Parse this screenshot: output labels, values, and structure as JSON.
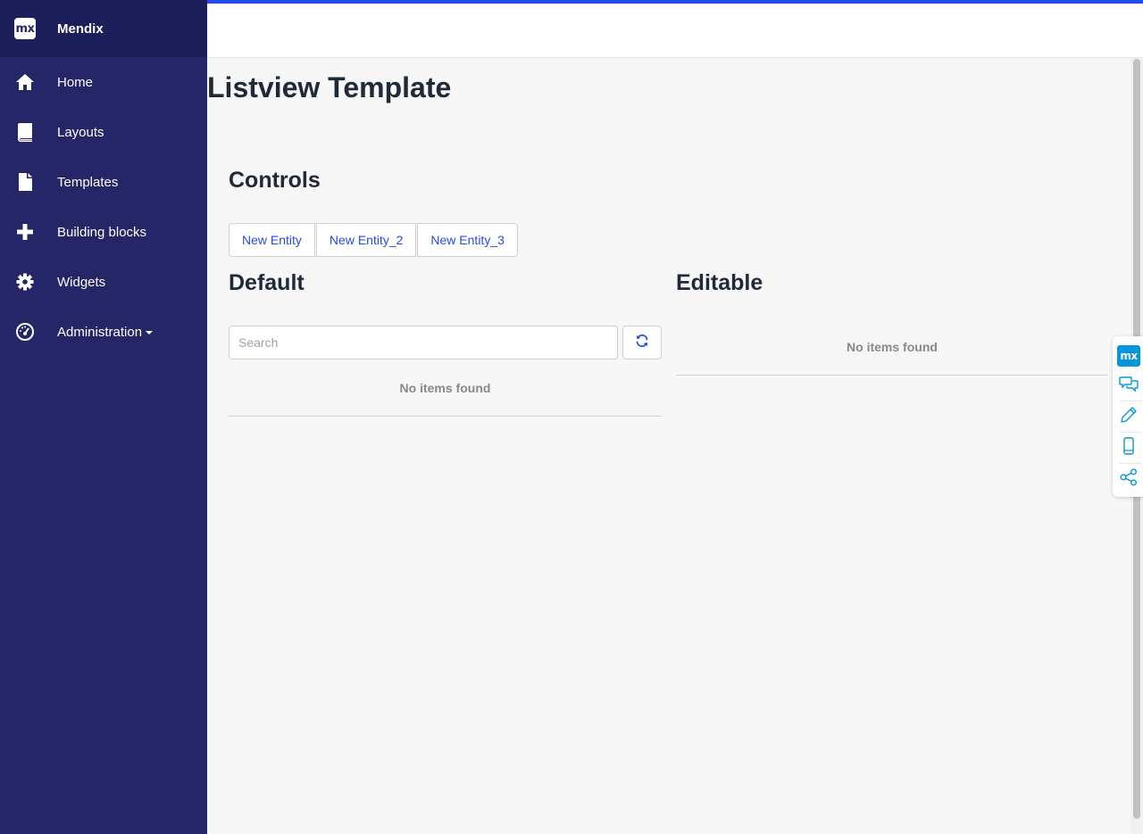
{
  "sidebar": {
    "brand": {
      "logo_text": "mx",
      "name": "Mendix"
    },
    "items": [
      {
        "label": "Home",
        "icon": "home-icon"
      },
      {
        "label": "Layouts",
        "icon": "book-icon"
      },
      {
        "label": "Templates",
        "icon": "file-icon"
      },
      {
        "label": "Building blocks",
        "icon": "plus-icon"
      },
      {
        "label": "Widgets",
        "icon": "gear-icon"
      },
      {
        "label": "Administration",
        "icon": "dashboard-icon",
        "has_dropdown": true
      }
    ]
  },
  "main": {
    "page_title": "Listview Template",
    "controls": {
      "title": "Controls",
      "buttons": [
        "New Entity",
        "New Entity_2",
        "New Entity_3"
      ]
    },
    "default_section": {
      "title": "Default",
      "search_placeholder": "Search",
      "empty_text": "No items found"
    },
    "editable_section": {
      "title": "Editable",
      "empty_text": "No items found"
    }
  },
  "side_toolbar": {
    "logo_text": "mx",
    "items": [
      "chat-icon",
      "pencil-icon",
      "mobile-icon",
      "share-icon"
    ]
  },
  "colors": {
    "sidebar_bg": "#252667",
    "brand_bg": "#1d1f5a",
    "accent": "#264ae5",
    "toolbar_accent": "#0595db"
  }
}
